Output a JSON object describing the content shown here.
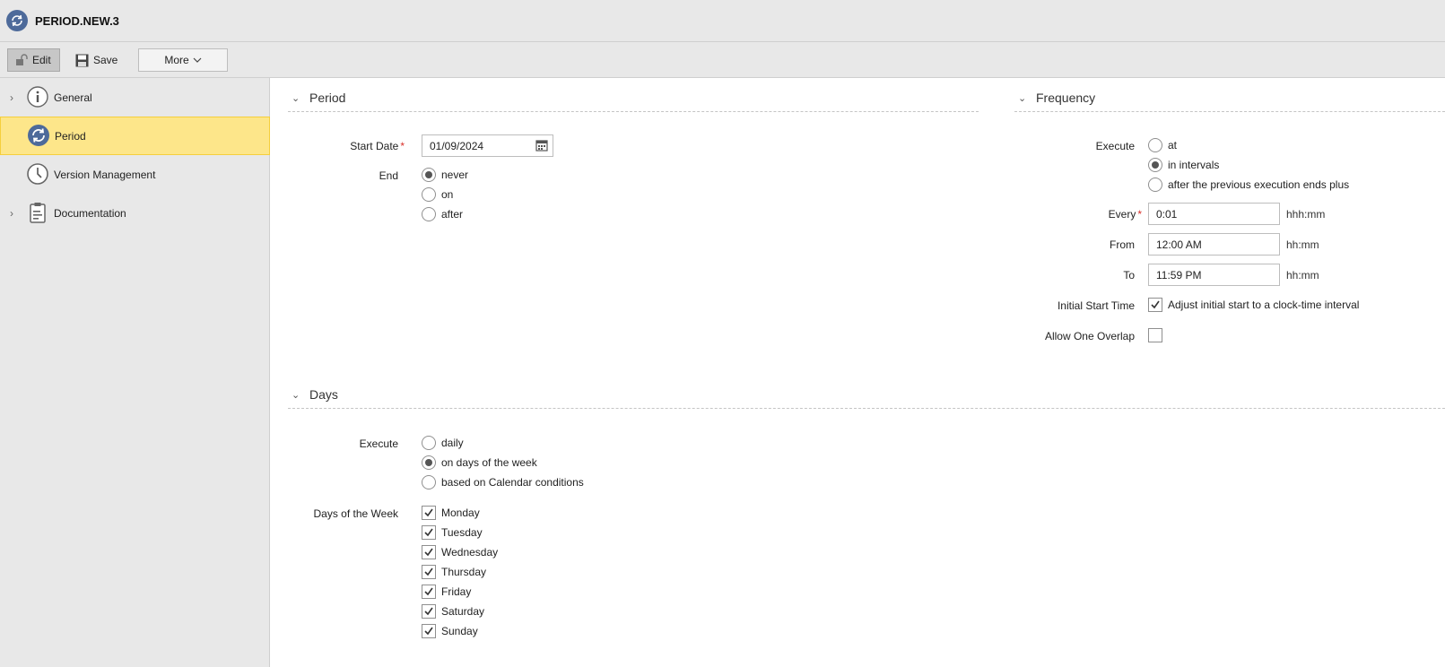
{
  "window": {
    "title": "PERIOD.NEW.3"
  },
  "toolbar": {
    "edit_label": "Edit",
    "save_label": "Save",
    "more_label": "More"
  },
  "sidebar": {
    "items": [
      {
        "label": "General",
        "icon": "info-icon"
      },
      {
        "label": "Period",
        "icon": "period-icon",
        "active": true
      },
      {
        "label": "Version Management",
        "icon": "clock-icon"
      },
      {
        "label": "Documentation",
        "icon": "clipboard-icon"
      }
    ]
  },
  "period": {
    "title": "Period",
    "start_date_label": "Start Date",
    "start_date_value": "01/09/2024",
    "end_label": "End",
    "end_options": [
      "never",
      "on",
      "after"
    ],
    "end_selected": "never"
  },
  "frequency": {
    "title": "Frequency",
    "execute_label": "Execute",
    "execute_options": [
      "at",
      "in intervals",
      "after the previous execution ends plus"
    ],
    "execute_selected": "in intervals",
    "every_label": "Every",
    "every_value": "0:01",
    "every_unit": "hhh:mm",
    "from_label": "From",
    "from_value": "12:00 AM",
    "from_unit": "hh:mm",
    "to_label": "To",
    "to_value": "11:59 PM",
    "to_unit": "hh:mm",
    "initial_start_label": "Initial Start Time",
    "initial_start_option": "Adjust initial start to a clock-time interval",
    "initial_start_checked": true,
    "overlap_label": "Allow One Overlap",
    "overlap_checked": false
  },
  "days": {
    "title": "Days",
    "execute_label": "Execute",
    "execute_options": [
      "daily",
      "on days of the week",
      "based on Calendar conditions"
    ],
    "execute_selected": "on days of the week",
    "dow_label": "Days of the Week",
    "weekdays": [
      "Monday",
      "Tuesday",
      "Wednesday",
      "Thursday",
      "Friday",
      "Saturday",
      "Sunday"
    ],
    "weekdays_checked": [
      true,
      true,
      true,
      true,
      true,
      true,
      true
    ]
  },
  "colors": {
    "accent": "#4d6a9a",
    "selected_nav": "#fde68a",
    "required": "#d9302a"
  }
}
